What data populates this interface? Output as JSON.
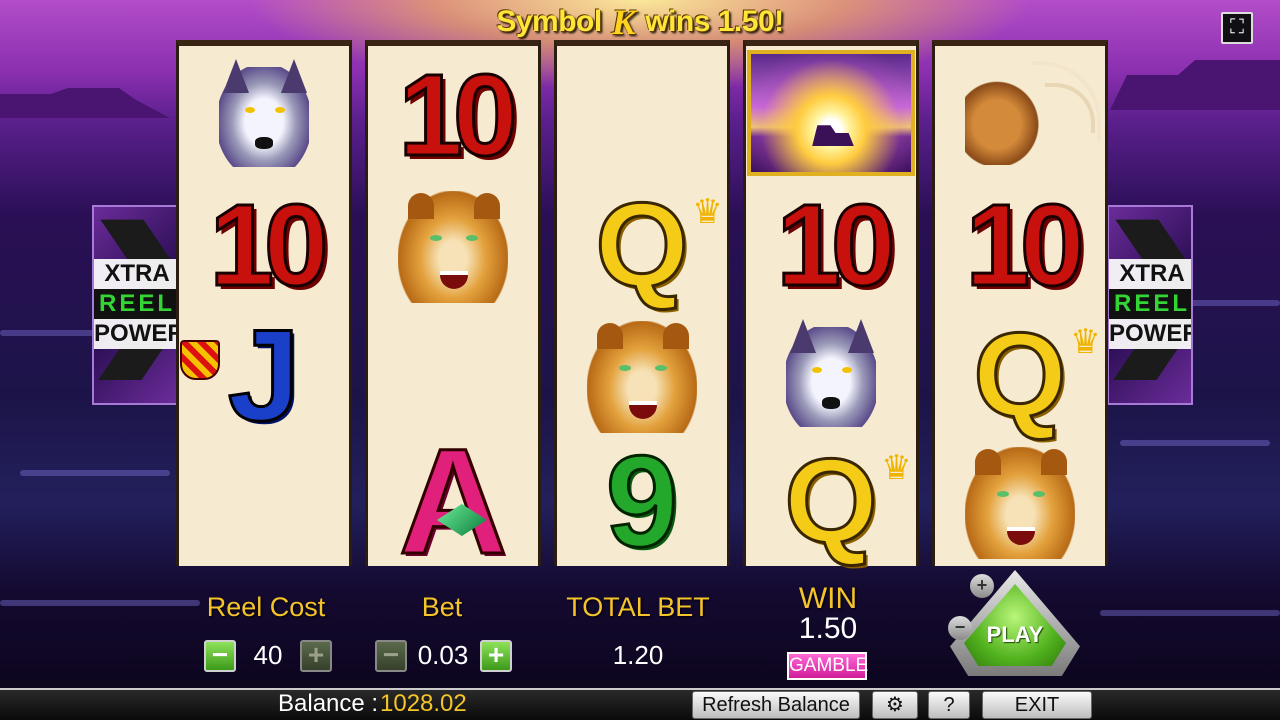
{
  "title": {
    "prefix": "Symbol",
    "symbol_glyph": "K",
    "suffix": "wins 1.50!"
  },
  "fullscreen_icon": "fullscreen-icon",
  "side_panel": {
    "big_letter": "X",
    "line1": "XTRA",
    "line2": "REEL",
    "line3": "POWER"
  },
  "reels": [
    [
      "wolf",
      "10",
      "J",
      "blank"
    ],
    [
      "10",
      "cougar",
      "blank",
      "A"
    ],
    [
      "blank",
      "Q",
      "cougar",
      "9"
    ],
    [
      "sunset",
      "10",
      "wolf",
      "Q"
    ],
    [
      "elk",
      "10",
      "Q",
      "cougar"
    ]
  ],
  "controls": {
    "reel_cost": {
      "label": "Reel Cost",
      "value": "40",
      "minus": "−",
      "plus": "+"
    },
    "bet": {
      "label": "Bet",
      "value": "0.03",
      "minus": "−",
      "plus": "+"
    },
    "total_bet": {
      "label": "TOTAL BET",
      "value": "1.20"
    },
    "win": {
      "label": "WIN",
      "value": "1.50"
    },
    "gamble": "GAMBLE",
    "play": "PLAY",
    "lines_plus": "+",
    "lines_minus": "−"
  },
  "bottom_bar": {
    "balance_label": "Balance :",
    "balance_value": "1028.02",
    "refresh": "Refresh Balance",
    "settings_icon": "gear-icon",
    "help": "?",
    "exit": "EXIT"
  },
  "colors": {
    "accent_gold": "#f5c32a",
    "play_green": "#52b21e",
    "gamble_pink": "#d01c9a",
    "ten_red": "#c8100c",
    "queen_yellow": "#f4cc17",
    "jack_blue": "#1a3fc9",
    "ace_pink": "#e0207a",
    "nine_green": "#23a82b"
  }
}
